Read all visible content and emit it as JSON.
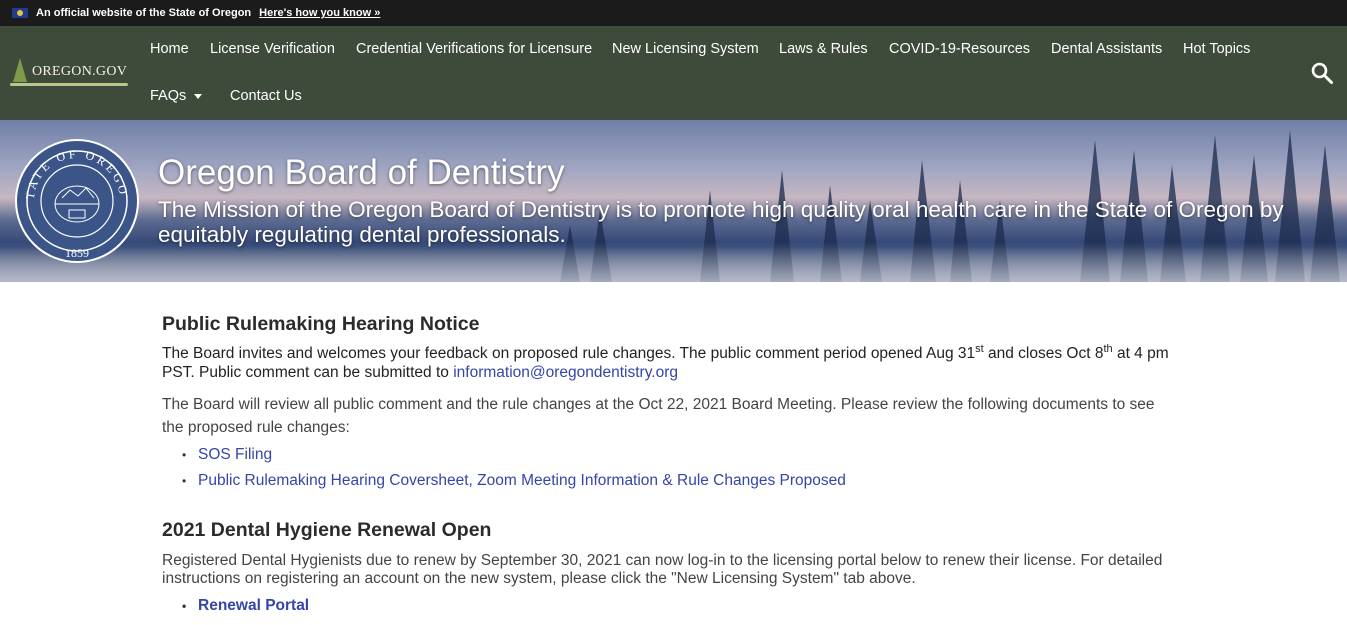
{
  "official_bar": {
    "text": "An official website of the State of Oregon",
    "link": "Here's how you know »"
  },
  "nav": {
    "logo_text": "OREGON.GOV",
    "items": [
      {
        "label": "Home"
      },
      {
        "label": "License Verification"
      },
      {
        "label": "Credential Verifications for Licensure"
      },
      {
        "label": "New Licensing System"
      },
      {
        "label": "Laws & Rules"
      },
      {
        "label": "COVID-19-Resources"
      },
      {
        "label": "Dental Assistants"
      },
      {
        "label": "Hot Topics"
      },
      {
        "label": "FAQs"
      },
      {
        "label": "Contact Us"
      }
    ],
    "search_icon": "search-icon"
  },
  "hero": {
    "seal_top": "STATE OF OREGON",
    "seal_year": "1859",
    "title": "Oregon Board of Dentistry",
    "mission": "The Mission of the Oregon Board of Dentistry is to promote high quality oral health care in the State of Oregon by equitably regulating dental professionals."
  },
  "section1": {
    "heading": "Public Rulemaking Hearing Notice",
    "p1_a": "The Board invites and welcomes your feedback on proposed rule changes. The public comment period opened Aug 31",
    "p1_sup1": "st",
    "p1_b": " and closes Oct 8",
    "p1_sup2": "th",
    "p1_c": " at 4 pm PST.  Public comment can be submitted to ",
    "email": "information@oregondentistry.org",
    "p2": "The Board will review all public comment and the rule changes at the Oct 22, 2021 Board Meeting. Please review the following documents  to see the proposed rule changes:",
    "links": [
      "SOS Filing",
      "Public Rulemaking Hearing Coversheet, Zoom Meeting Information & Rule Changes Proposed"
    ]
  },
  "section2": {
    "heading": "2021 Dental Hygiene Renewal Open",
    "p": "Registered Dental Hygienists due to renew by September 30, 2021 can now log-in to the licensing portal below to renew their license. For detailed instructions on registering an account on the new system, please click the \"New Licensing System\" tab above.",
    "links": [
      "Renewal Portal"
    ]
  },
  "colors": {
    "nav_bg": "#3e4a3a",
    "official_bar_bg": "#1b1b1b",
    "link": "#3545a8"
  }
}
